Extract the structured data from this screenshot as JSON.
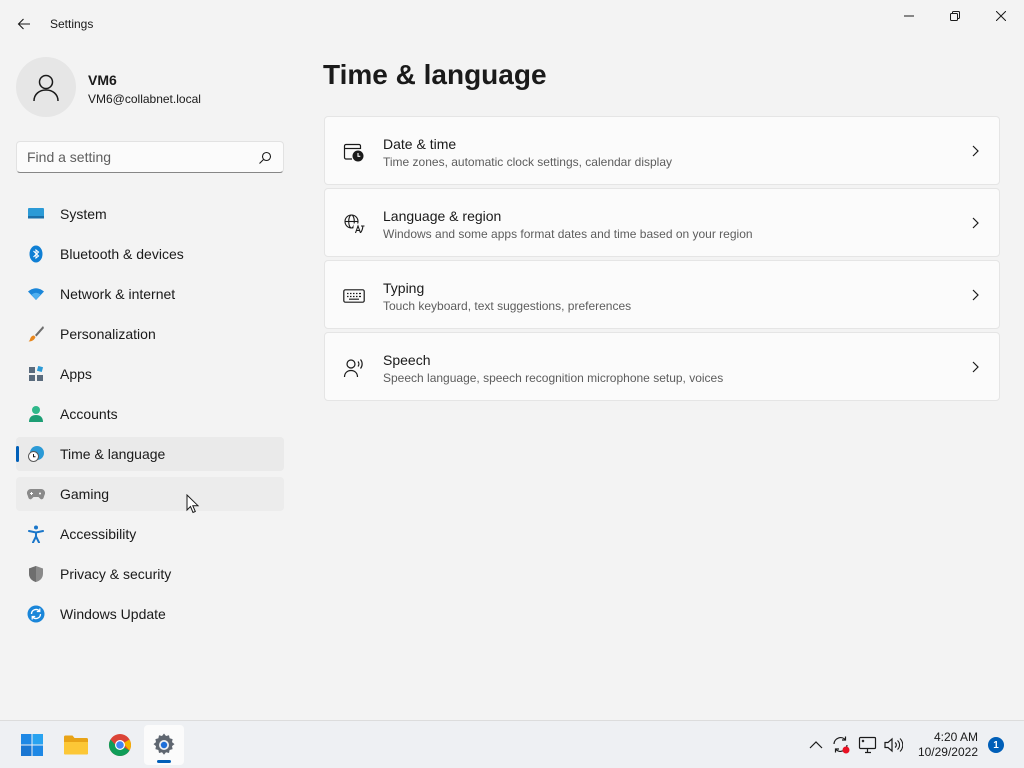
{
  "window": {
    "title": "Settings"
  },
  "profile": {
    "name": "VM6",
    "email": "VM6@collabnet.local"
  },
  "search": {
    "placeholder": "Find a setting"
  },
  "nav": {
    "items": [
      {
        "label": "System",
        "icon": "system-icon"
      },
      {
        "label": "Bluetooth & devices",
        "icon": "bluetooth-icon"
      },
      {
        "label": "Network & internet",
        "icon": "wifi-icon"
      },
      {
        "label": "Personalization",
        "icon": "brush-icon"
      },
      {
        "label": "Apps",
        "icon": "apps-icon"
      },
      {
        "label": "Accounts",
        "icon": "accounts-icon"
      },
      {
        "label": "Time & language",
        "icon": "globe-clock-icon",
        "selected": true
      },
      {
        "label": "Gaming",
        "icon": "gamepad-icon"
      },
      {
        "label": "Accessibility",
        "icon": "accessibility-icon"
      },
      {
        "label": "Privacy & security",
        "icon": "shield-icon"
      },
      {
        "label": "Windows Update",
        "icon": "update-icon"
      }
    ]
  },
  "main": {
    "title": "Time & language",
    "cards": [
      {
        "title": "Date & time",
        "desc": "Time zones, automatic clock settings, calendar display",
        "icon": "calendar-clock-icon"
      },
      {
        "title": "Language & region",
        "desc": "Windows and some apps format dates and time based on your region",
        "icon": "language-icon"
      },
      {
        "title": "Typing",
        "desc": "Touch keyboard, text suggestions, preferences",
        "icon": "keyboard-icon"
      },
      {
        "title": "Speech",
        "desc": "Speech language, speech recognition microphone setup, voices",
        "icon": "speech-icon"
      }
    ]
  },
  "taskbar": {
    "apps": [
      "start-icon",
      "file-explorer-icon",
      "chrome-icon",
      "settings-icon"
    ],
    "clock": {
      "time": "4:20 AM",
      "date": "10/29/2022"
    },
    "notifications": "1"
  },
  "colors": {
    "accent": "#005fb8",
    "background": "#f3f3f3"
  }
}
